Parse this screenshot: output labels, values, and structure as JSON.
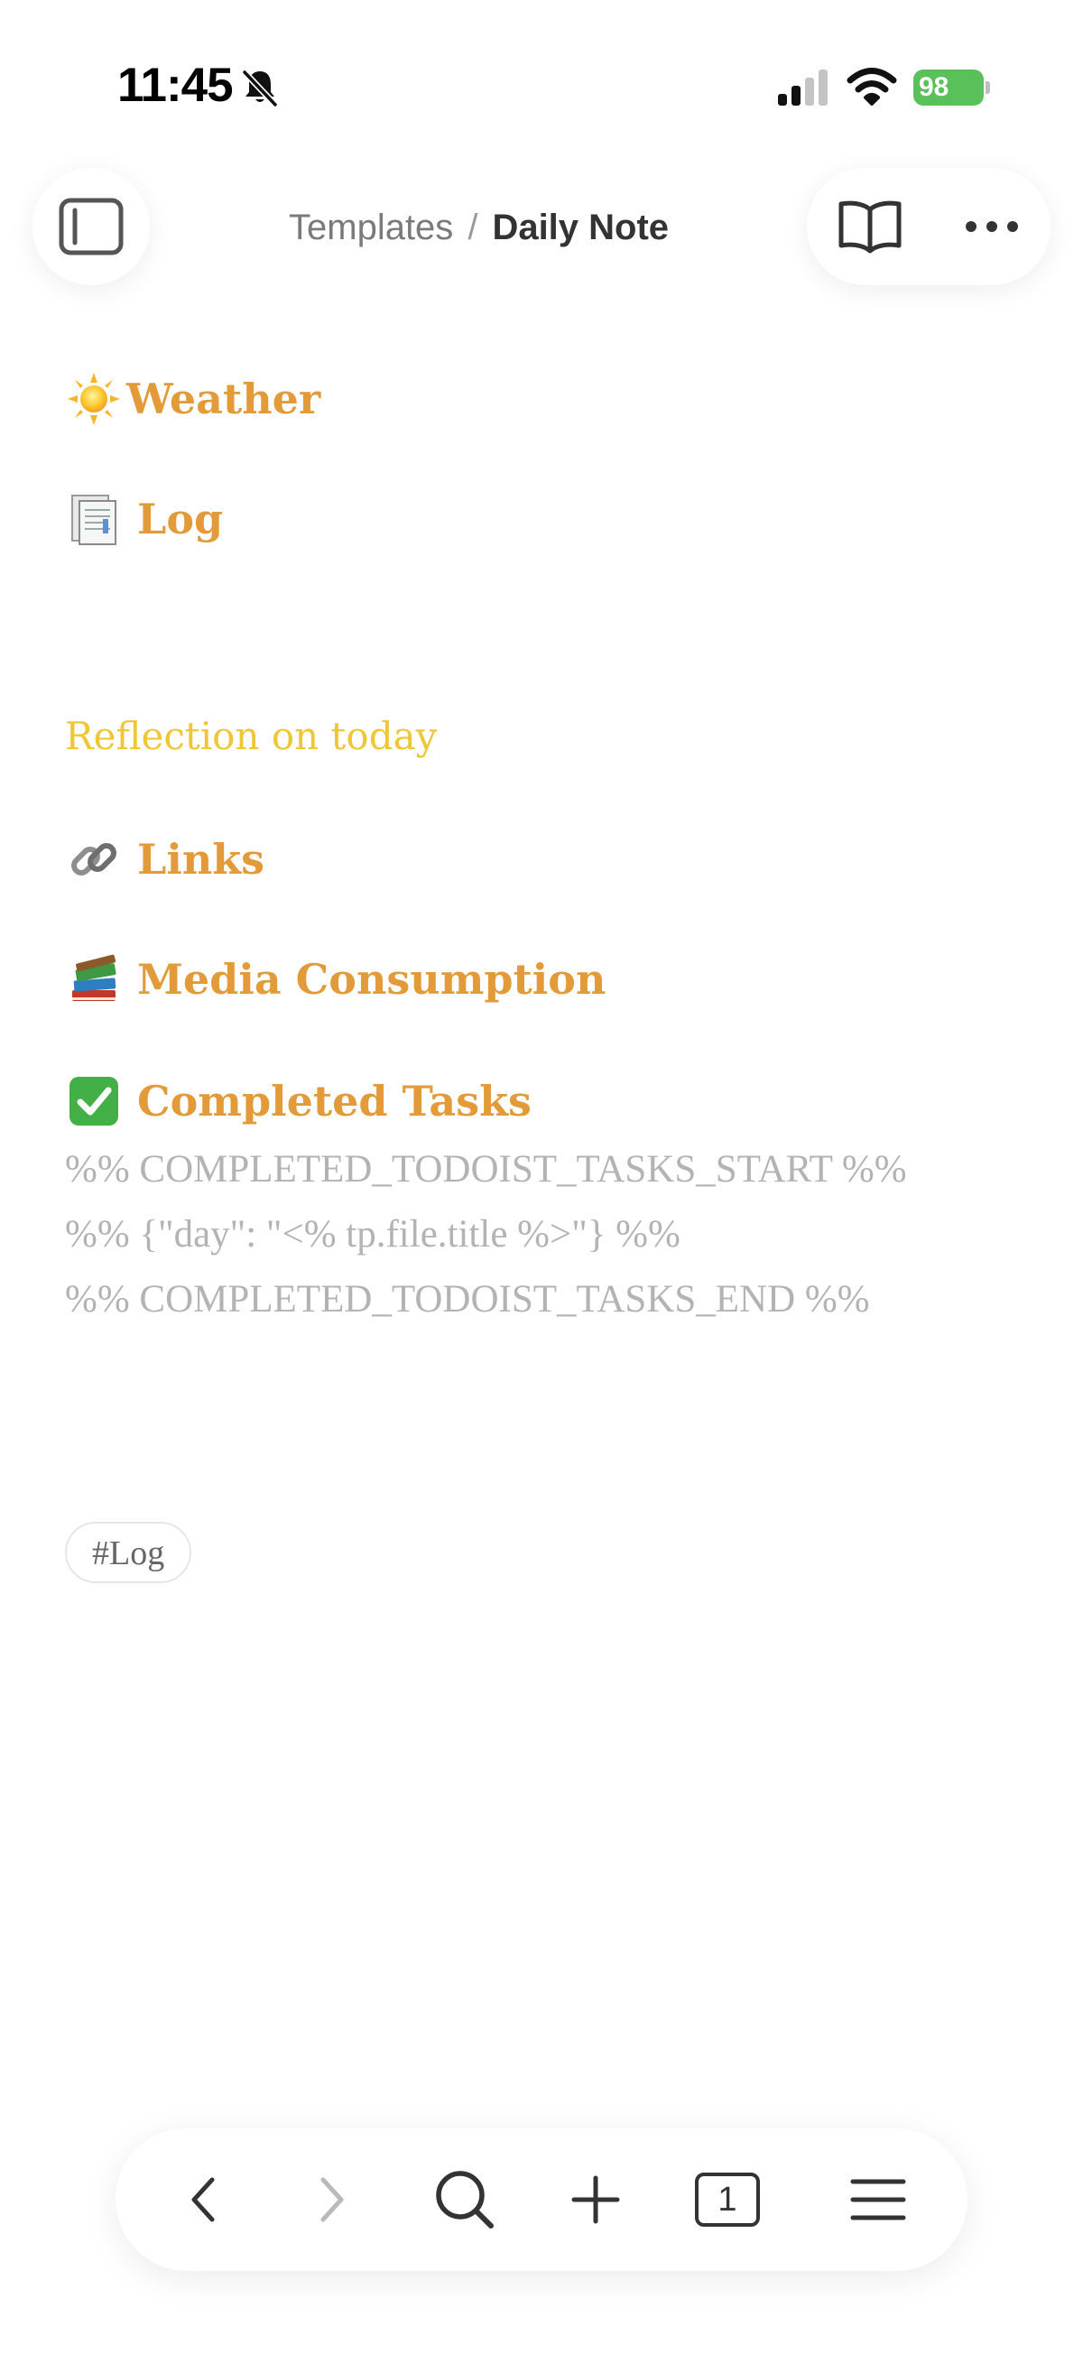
{
  "status_bar": {
    "time": "11:45",
    "battery_level": "98",
    "icons": [
      "bell-slash-icon",
      "cellular-signal-icon",
      "wifi-icon",
      "battery-charging-icon"
    ]
  },
  "header": {
    "breadcrumb_parent": "Templates",
    "breadcrumb_separator": "/",
    "breadcrumb_current": "Daily Note",
    "icons": [
      "sidebar-toggle-icon",
      "book-open-icon",
      "ellipsis-icon"
    ]
  },
  "note": {
    "sections": [
      {
        "emoji": "sun-emoji",
        "label": "Weather"
      },
      {
        "emoji": "page-emoji",
        "label": "Log"
      },
      {
        "emoji": "link-emoji",
        "label": "Links"
      },
      {
        "emoji": "books-emoji",
        "label": "Media Consumption"
      },
      {
        "emoji": "check-mark-emoji",
        "label": "Completed Tasks"
      }
    ],
    "reflection": "Reflection on today",
    "code_lines": [
      "%% COMPLETED_TODOIST_TASKS_START %%",
      "%% {\"day\": \"<% tp.file.title %>\"} %%",
      "%% COMPLETED_TODOIST_TASKS_END %%"
    ],
    "tag": "#Log"
  },
  "toolbar": {
    "tab_count": "1",
    "icons": [
      "chevron-left-icon",
      "chevron-right-icon",
      "search-icon",
      "plus-icon",
      "tabs-icon",
      "hamburger-menu-icon"
    ]
  },
  "colors": {
    "heading": "#e39b3a",
    "reflection": "#efc636",
    "comment": "#b3b3b3",
    "battery": "#5ac05a"
  }
}
